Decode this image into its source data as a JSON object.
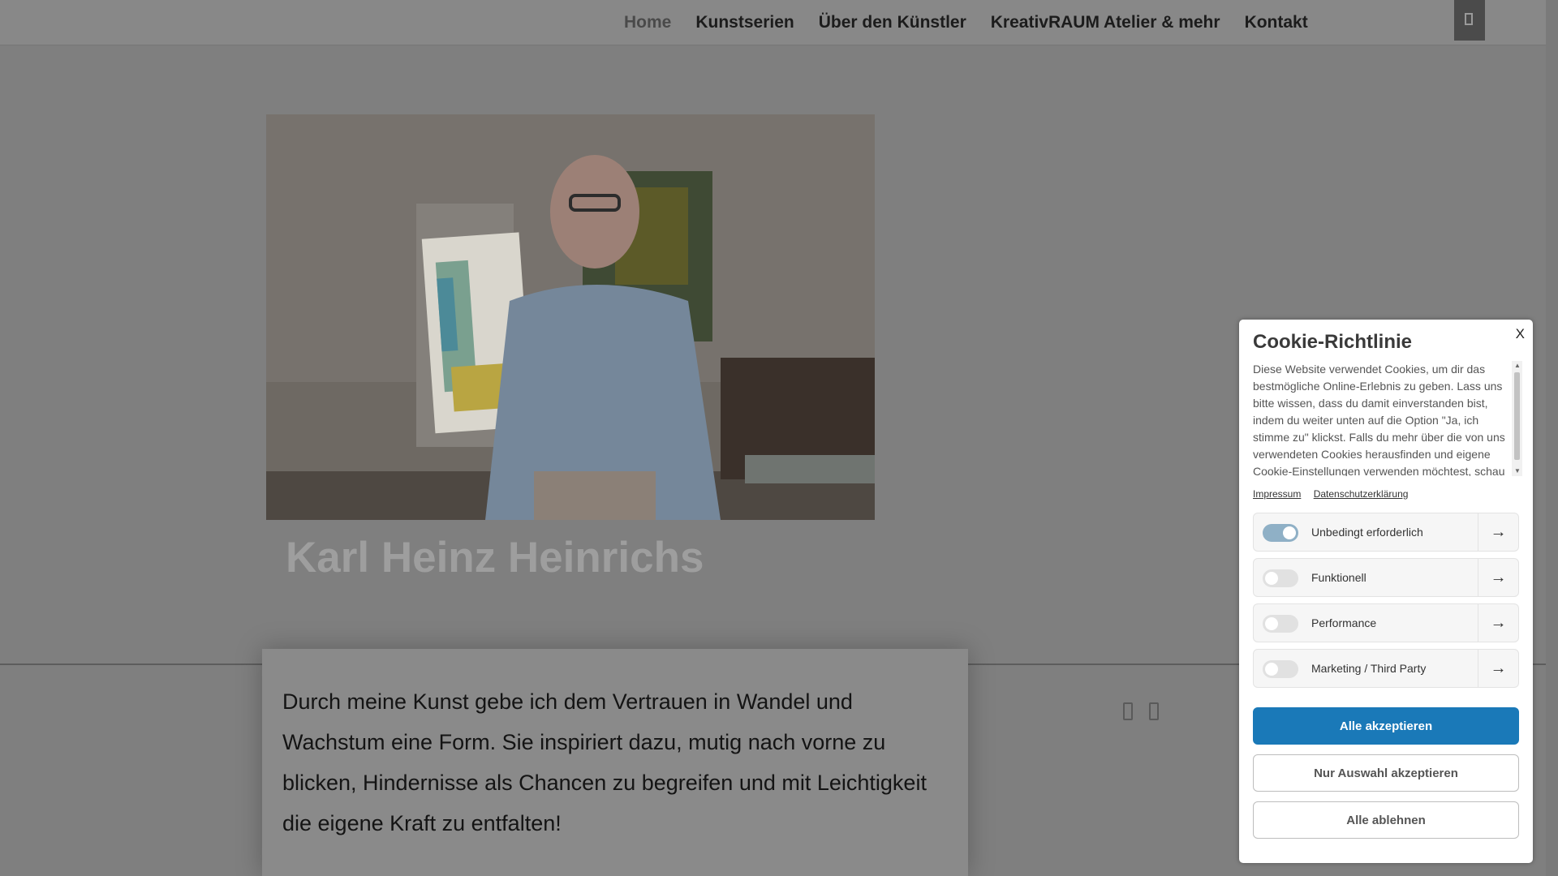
{
  "nav": {
    "items": [
      {
        "label": "Home",
        "active": true
      },
      {
        "label": "Kunstserien"
      },
      {
        "label": "Über den Künstler"
      },
      {
        "label": "KreativRAUM Atelier & mehr"
      },
      {
        "label": "Kontakt"
      }
    ]
  },
  "hero": {
    "title": "Karl Heinz Heinrichs"
  },
  "content": {
    "text": "Durch meine Kunst gebe ich dem Vertrauen in Wandel und Wachstum eine Form. Sie inspiriert dazu, mutig nach vorne zu blicken, Hindernisse als Chancen zu begreifen und mit Leichtigkeit die eigene Kraft zu entfalten!"
  },
  "cookie": {
    "close_label": "X",
    "title": "Cookie-Richtlinie",
    "description": "Diese Website verwendet Cookies, um dir das bestmögliche Online-Erlebnis zu geben. Lass uns bitte wissen, dass du damit einverstanden bist, indem du weiter unten auf die Option \"Ja, ich stimme zu\" klickst. Falls du mehr über die von uns verwendeten Cookies herausfinden und eigene Cookie-Einstellungen verwenden möchtest, schau",
    "links": {
      "impressum": "Impressum",
      "privacy": "Datenschutzerklärung"
    },
    "categories": [
      {
        "label": "Unbedingt erforderlich",
        "enabled": true
      },
      {
        "label": "Funktionell",
        "enabled": false
      },
      {
        "label": "Performance",
        "enabled": false
      },
      {
        "label": "Marketing / Third Party",
        "enabled": false
      }
    ],
    "buttons": {
      "accept_all": "Alle akzeptieren",
      "accept_selection": "Nur Auswahl akzeptieren",
      "reject_all": "Alle ablehnen"
    },
    "colors": {
      "primary": "#1a79b8",
      "toggle_on": "#8fb0c6"
    }
  }
}
